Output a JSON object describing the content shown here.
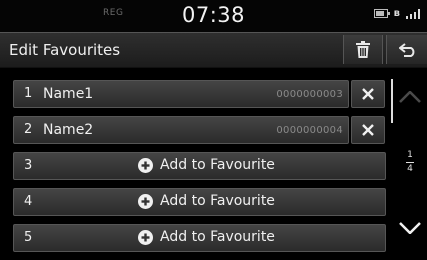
{
  "status_bar": {
    "reg": "REG",
    "time": "07:38"
  },
  "header": {
    "title": "Edit Favourites",
    "delete_icon": "trash-icon",
    "back_icon": "back-arrow-icon"
  },
  "favourites": [
    {
      "num": "1",
      "name": "Name1",
      "phone": "0000000003"
    },
    {
      "num": "2",
      "name": "Name2",
      "phone": "0000000004"
    }
  ],
  "empty_slots": [
    {
      "num": "3",
      "label": "Add to Favourite"
    },
    {
      "num": "4",
      "label": "Add to Favourite"
    },
    {
      "num": "5",
      "label": "Add to Favourite"
    }
  ],
  "pagination": {
    "current": "1",
    "total": "4"
  },
  "colors": {
    "background": "#000000",
    "row": "#3a3a3a",
    "text": "#f0f0f0",
    "phone": "#8a8a8a"
  }
}
